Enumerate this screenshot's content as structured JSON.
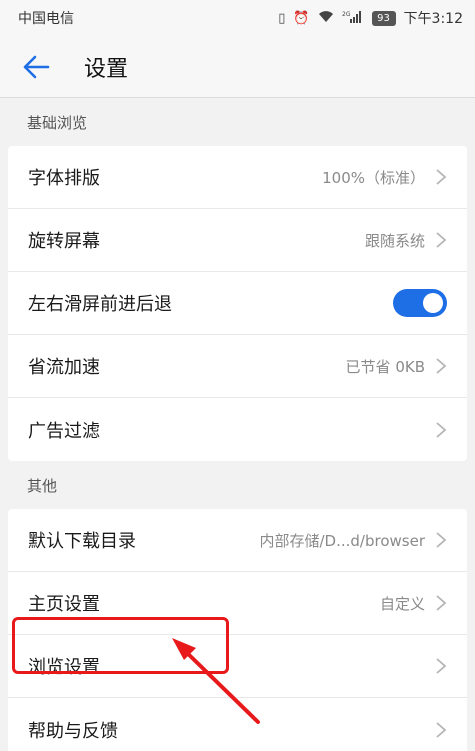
{
  "status_bar": {
    "carrier": "中国电信",
    "battery": "93",
    "time": "下午3:12",
    "network": "2G"
  },
  "app_bar": {
    "title": "设置"
  },
  "sections": [
    {
      "header": "基础浏览",
      "items": [
        {
          "label": "字体排版",
          "value": "100%（标准）",
          "type": "link"
        },
        {
          "label": "旋转屏幕",
          "value": "跟随系统",
          "type": "link"
        },
        {
          "label": "左右滑屏前进后退",
          "value": "",
          "type": "toggle",
          "on": true
        },
        {
          "label": "省流加速",
          "value": "已节省 0KB",
          "type": "link"
        },
        {
          "label": "广告过滤",
          "value": "",
          "type": "link"
        }
      ]
    },
    {
      "header": "其他",
      "items": [
        {
          "label": "默认下载目录",
          "value": "内部存储/D...d/browser",
          "type": "link"
        },
        {
          "label": "主页设置",
          "value": "自定义",
          "type": "link"
        },
        {
          "label": "浏览设置",
          "value": "",
          "type": "link"
        },
        {
          "label": "帮助与反馈",
          "value": "",
          "type": "link"
        }
      ]
    }
  ],
  "colors": {
    "accent": "#1e6fe6",
    "highlight": "#e8191a"
  }
}
